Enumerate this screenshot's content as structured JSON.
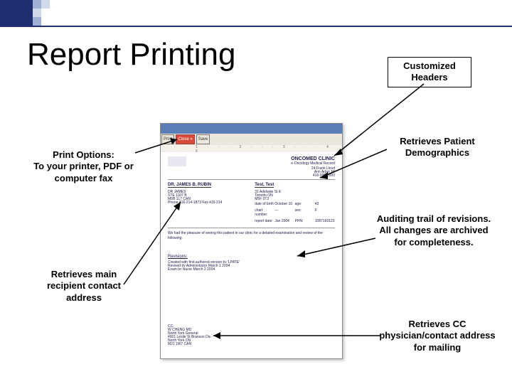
{
  "title": "Report Printing",
  "annotations": {
    "headers": "Customized Headers",
    "printopts_l1": "Print Options:",
    "printopts_l2": "To your printer, PDF or",
    "printopts_l3": "computer fax",
    "demo": "Retrieves Patient Demographics",
    "audit_l1": "Auditing trail of revisions.",
    "audit_l2": "All changes are archived",
    "audit_l3": "for completeness.",
    "recip_l1": "Retrieves main",
    "recip_l2": "recipient contact",
    "recip_l3": "address",
    "cc_l1": "Retrieves CC",
    "cc_l2": "physician/contact address",
    "cc_l3": "for mailing"
  },
  "screenshot": {
    "toolbar": {
      "print": "Print",
      "close": "Close »",
      "save": "Save"
    },
    "clinic": "ONCOMED CLINIC",
    "clinic_sub": "e-Oncology Medical Record",
    "doctor": "DR. JAMES B. RUBIN",
    "patient": "Test, Test",
    "body_line": "We had the pleasure of seeing this patient in our clinic for a detailed examination and review of the following.",
    "rev_head": "Revisions:"
  }
}
